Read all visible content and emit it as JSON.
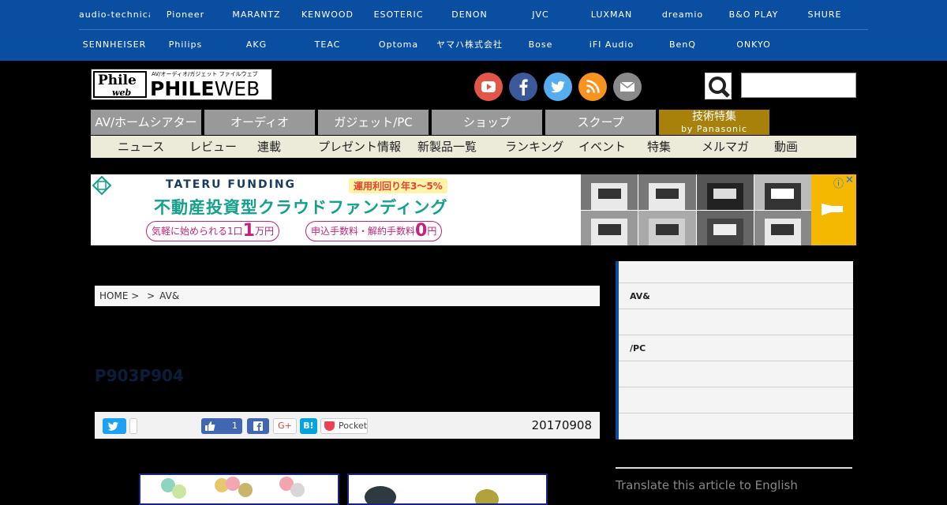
{
  "brands": {
    "row1": [
      "audio-technica",
      "Pioneer",
      "MARANTZ",
      "KENWOOD",
      "ESOTERIC",
      "DENON",
      "JVC",
      "LUXMAN",
      "dreamio",
      "B&O PLAY",
      "SHURE"
    ],
    "row2": [
      "SENNHEISER",
      "Philips",
      "AKG",
      "TEAC",
      "Optoma",
      "ヤマハ株式会社",
      "Bose",
      "iFI Audio",
      "BenQ",
      "ONKYO"
    ]
  },
  "logo": {
    "badge_top": "Phile",
    "badge_bottom": "web",
    "tagline": "AV/オーディオ/ガジェット ファイルウェブ",
    "word_bold": "PHILE",
    "word_light": "WEB"
  },
  "social": [
    "youtube-icon",
    "facebook-icon",
    "twitter-icon",
    "rss-icon",
    "mail-icon"
  ],
  "search": {
    "placeholder": ""
  },
  "main_nav": [
    "AV/ホームシアター",
    "オーディオ",
    "ガジェット/PC",
    "ショップ",
    "スクープ",
    {
      "line1": "技術特集",
      "line2": "by Panasonic"
    }
  ],
  "sub_nav": [
    "ニュース",
    "レビュー",
    "連載",
    "プレゼント情報",
    "新製品一覧",
    "ランキング",
    "イベント",
    "特集",
    "メルマガ",
    "動画"
  ],
  "ad": {
    "company": "TATERU FUNDING",
    "yield": "運用利回り年3〜5%",
    "headline": "不動産投資型クラウドファンディング",
    "pill1_text": "気軽に始められる1口",
    "pill1_num": "1",
    "pill1_unit": "万円",
    "pill2_text": "申込手数料・解約手数料",
    "pill2_num": "0",
    "pill2_unit": "円",
    "info": "ⓘ",
    "close": "✕"
  },
  "breadcrumb": {
    "home": "HOME >",
    "sep": ">",
    "current": "AV&"
  },
  "article": {
    "title": "P903P904"
  },
  "share": {
    "like_count": "1",
    "gplus": "G+",
    "hatena": "B!",
    "pocket": "Pocket",
    "date": "20170908"
  },
  "sidebar": {
    "items": [
      "",
      "AV&",
      "",
      "/PC",
      "",
      "",
      ""
    ]
  },
  "translate": "Translate this article to English",
  "colors": {
    "brand_bar": "#0a4ea1",
    "nav_tab": "#999999",
    "nav_special": "#a8810b",
    "sub_nav": "#ecebd9"
  }
}
